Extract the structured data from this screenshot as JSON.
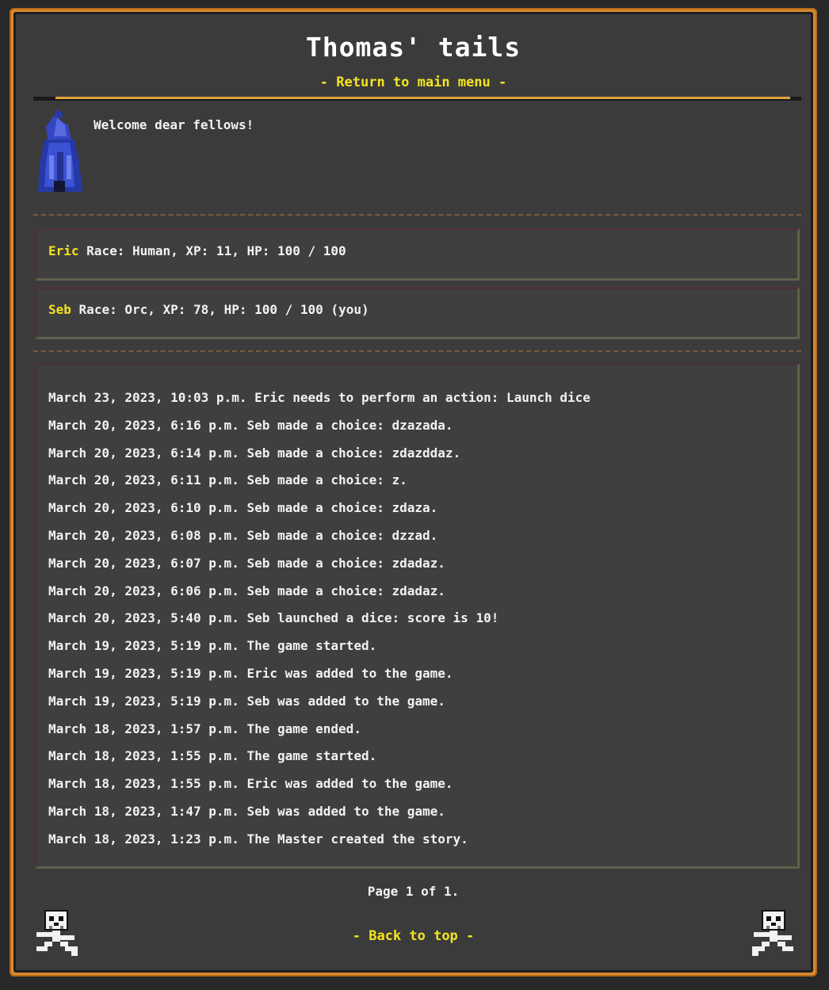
{
  "header": {
    "title": "Thomas' tails",
    "menu_link": "- Return to main menu -"
  },
  "intro": {
    "welcome": "Welcome dear fellows!"
  },
  "players": [
    {
      "name": "Eric",
      "details": "Race: Human, XP: 11, HP: 100 / 100"
    },
    {
      "name": "Seb",
      "details": "Race: Orc, XP: 78, HP: 100 / 100 (you)"
    }
  ],
  "log": [
    "March 23, 2023, 10:03 p.m. Eric needs to perform an action: Launch dice",
    "March 20, 2023, 6:16 p.m. Seb made a choice: dzazada.",
    "March 20, 2023, 6:14 p.m. Seb made a choice: zdazddaz.",
    "March 20, 2023, 6:11 p.m. Seb made a choice: z.",
    "March 20, 2023, 6:10 p.m. Seb made a choice: zdaza.",
    "March 20, 2023, 6:08 p.m. Seb made a choice: dzzad.",
    "March 20, 2023, 6:07 p.m. Seb made a choice: zdadaz.",
    "March 20, 2023, 6:06 p.m. Seb made a choice: zdadaz.",
    "March 20, 2023, 5:40 p.m. Seb launched a dice: score is 10!",
    "March 19, 2023, 5:19 p.m. The game started.",
    "March 19, 2023, 5:19 p.m. Eric was added to the game.",
    "March 19, 2023, 5:19 p.m. Seb was added to the game.",
    "March 18, 2023, 1:57 p.m. The game ended.",
    "March 18, 2023, 1:55 p.m. The game started.",
    "March 18, 2023, 1:55 p.m. Eric was added to the game.",
    "March 18, 2023, 1:47 p.m. Seb was added to the game.",
    "March 18, 2023, 1:23 p.m. The Master created the story."
  ],
  "footer": {
    "pagination": "Page 1 of 1.",
    "back_to_top": "- Back to top -"
  },
  "icons": {
    "avatar": "blue-hooded-wizard-icon",
    "corner": "skull-pirate-icon"
  },
  "colors": {
    "accent": "#f4e420",
    "frame": "#d98a2e",
    "panel": "#3b3b3b"
  }
}
